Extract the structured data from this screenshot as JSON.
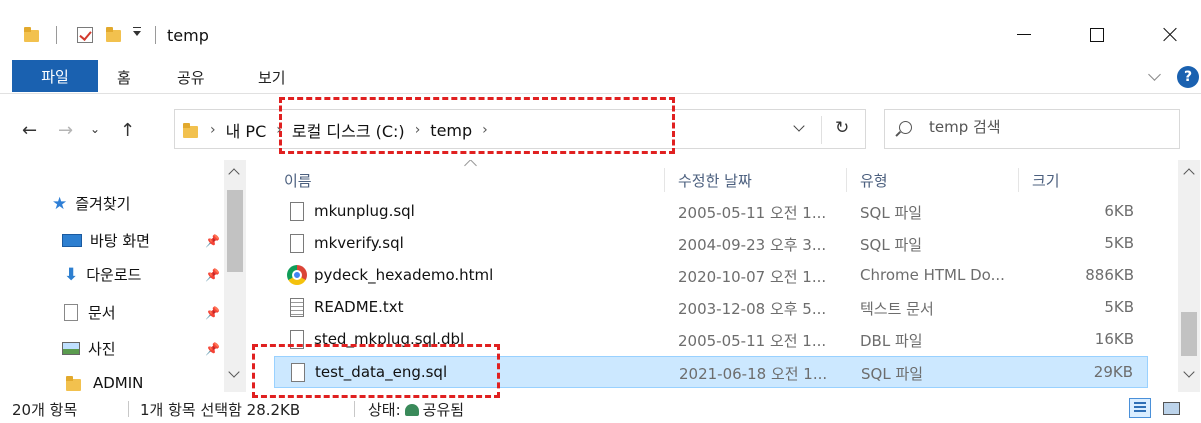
{
  "window": {
    "title": "temp"
  },
  "ribbon": {
    "tabs": [
      "파일",
      "홈",
      "공유",
      "보기"
    ],
    "help": "?"
  },
  "addressbar": {
    "breadcrumbs": [
      "내 PC",
      "로컬 디스크 (C:)",
      "temp"
    ]
  },
  "search": {
    "placeholder": "temp 검색"
  },
  "navpane": {
    "items": [
      {
        "label": "즐겨찾기",
        "icon": "star-icon",
        "pinned": false
      },
      {
        "label": "바탕 화면",
        "icon": "desktop-icon",
        "pinned": true
      },
      {
        "label": "다운로드",
        "icon": "download-icon",
        "pinned": true
      },
      {
        "label": "문서",
        "icon": "document-icon",
        "pinned": true
      },
      {
        "label": "사진",
        "icon": "pictures-icon",
        "pinned": true
      },
      {
        "label": "ADMIN",
        "icon": "folder-icon",
        "pinned": false
      }
    ]
  },
  "filelist": {
    "columns": [
      "이름",
      "수정한 날짜",
      "유형",
      "크기"
    ],
    "rows": [
      {
        "name": "mkunplug.sql",
        "date": "2005-05-11 오전 1...",
        "type": "SQL 파일",
        "size": "6KB",
        "icon": "file-icon",
        "selected": false
      },
      {
        "name": "mkverify.sql",
        "date": "2004-09-23 오후 3...",
        "type": "SQL 파일",
        "size": "5KB",
        "icon": "file-icon",
        "selected": false
      },
      {
        "name": "pydeck_hexademo.html",
        "date": "2020-10-07 오전 1...",
        "type": "Chrome HTML Do...",
        "size": "886KB",
        "icon": "chrome-icon",
        "selected": false
      },
      {
        "name": "README.txt",
        "date": "2003-12-08 오후 5...",
        "type": "텍스트 문서",
        "size": "5KB",
        "icon": "text-file-icon",
        "selected": false
      },
      {
        "name": "sted_mkplug.sql.dbl",
        "date": "2005-05-11 오전 1...",
        "type": "DBL 파일",
        "size": "16KB",
        "icon": "file-icon",
        "selected": false
      },
      {
        "name": "test_data_eng.sql",
        "date": "2021-06-18 오전 1...",
        "type": "SQL 파일",
        "size": "29KB",
        "icon": "file-icon",
        "selected": true
      }
    ]
  },
  "statusbar": {
    "item_count": "20개 항목",
    "selection": "1개 항목 선택함 28.2KB",
    "state_label": "상태:",
    "state_value": "공유됨"
  },
  "colors": {
    "accent": "#1a61b0",
    "selection": "#cce8ff",
    "annotation": "#e02020"
  }
}
